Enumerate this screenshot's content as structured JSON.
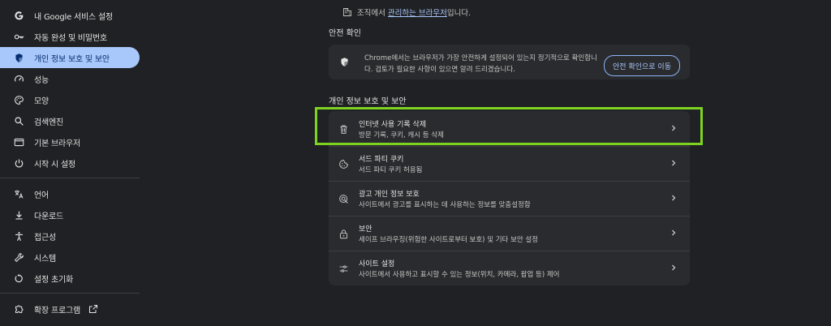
{
  "sidebar": {
    "items": [
      {
        "label": "내 Google 서비스 설정",
        "icon": "google-icon"
      },
      {
        "label": "자동 완성 및 비밀번호",
        "icon": "key-icon"
      },
      {
        "label": "개인 정보 보호 및 보안",
        "icon": "shield-icon",
        "active": true
      },
      {
        "label": "성능",
        "icon": "speedometer-icon"
      },
      {
        "label": "모양",
        "icon": "palette-icon"
      },
      {
        "label": "검색엔진",
        "icon": "search-icon"
      },
      {
        "label": "기본 브라우저",
        "icon": "browser-icon"
      },
      {
        "label": "시작 시 설정",
        "icon": "power-icon"
      },
      {
        "label": "언어",
        "icon": "translate-icon"
      },
      {
        "label": "다운로드",
        "icon": "download-icon"
      },
      {
        "label": "접근성",
        "icon": "accessibility-icon"
      },
      {
        "label": "시스템",
        "icon": "wrench-icon"
      },
      {
        "label": "설정 초기화",
        "icon": "reset-icon"
      },
      {
        "label": "확장 프로그램",
        "icon": "puzzle-icon"
      }
    ]
  },
  "notice": {
    "prefix": "조직에서",
    "link": "관리하는 브라우저",
    "suffix": "입니다."
  },
  "safety": {
    "section_title": "안전 확인",
    "text": "Chrome에서는 브라우저가 가장 안전하게 설정되어 있는지 정기적으로 확인합니다. 검토가 필요한 사항이 있으면 알려 드리겠습니다.",
    "button": "안전 확인으로 이동"
  },
  "privacy": {
    "section_title": "개인 정보 보호 및 보안",
    "rows": [
      {
        "title": "인터넷 사용 기록 삭제",
        "subtitle": "방문 기록, 쿠키, 캐시 등 삭제",
        "icon": "trash-icon"
      },
      {
        "title": "서드 파티 쿠키",
        "subtitle": "서드 파티 쿠키 허용됨",
        "icon": "cookie-icon"
      },
      {
        "title": "광고 개인 정보 보호",
        "subtitle": "사이트에서 광고를 표시하는 데 사용하는 정보를 맞춤설정함",
        "icon": "ad-privacy-icon"
      },
      {
        "title": "보안",
        "subtitle": "세이프 브라우징(위험한 사이트로부터 보호) 및 기타 보안 설정",
        "icon": "lock-icon"
      },
      {
        "title": "사이트 설정",
        "subtitle": "사이트에서 사용하고 표시할 수 있는 정보(위치, 카메라, 팝업 등) 제어",
        "icon": "sliders-icon"
      }
    ]
  },
  "colors": {
    "background": "#202124",
    "active_nav": "#a8c7fa",
    "card": "#2a2b2e",
    "highlight": "#7ed321"
  }
}
